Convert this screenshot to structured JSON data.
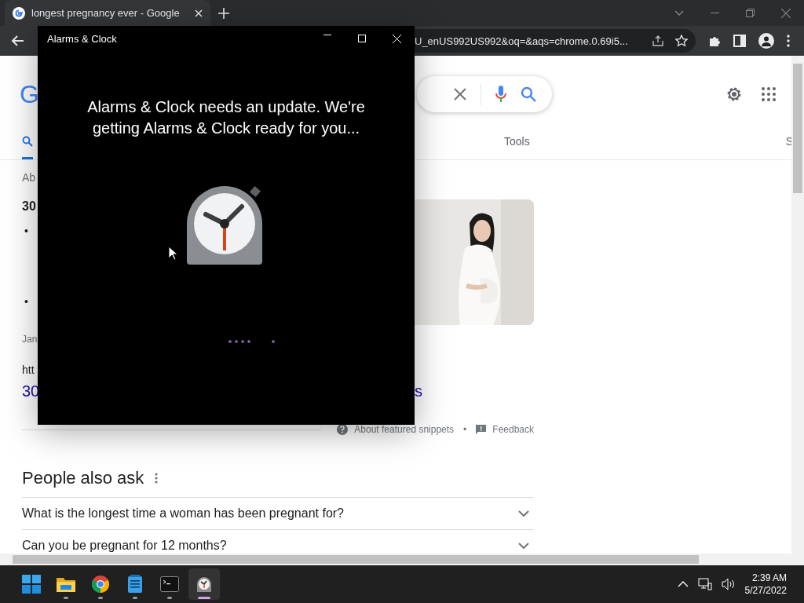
{
  "browser": {
    "tabs": [
      {
        "title": "longest pregnancy ever - Google",
        "selected": true
      }
    ],
    "omnibox": {
      "value": "U_enUS992US992&oq=&aqs=chrome.0.69i5..."
    }
  },
  "page": {
    "logo": "G",
    "nav": [
      {
        "kind": "search",
        "selected": true
      },
      {
        "kind": "text",
        "label": "Tools",
        "selected": false
      },
      {
        "kind": "text",
        "label": "S",
        "selected": false
      }
    ],
    "featured": {
      "about": "Ab",
      "heading": "30",
      "bullets": [
        "•",
        "•"
      ],
      "date": "Jan",
      "url": "htt",
      "link_start": "30",
      "link_end": "s"
    },
    "snippet_footer": {
      "about": "About featured snippets",
      "separator": "•",
      "feedback": "Feedback"
    },
    "people_also_ask": {
      "title": "People also ask",
      "questions": [
        "What is the longest time a woman has been pregnant for?",
        "Can you be pregnant for 12 months?"
      ]
    }
  },
  "app_window": {
    "title": "Alarms & Clock",
    "message": "Alarms & Clock needs an update. We're getting Alarms & Clock ready for you..."
  },
  "taskbar": {
    "apps": [
      {
        "selected": false
      },
      {
        "selected": false
      },
      {
        "selected": false
      },
      {
        "selected": false
      },
      {
        "selected": true
      }
    ],
    "clock": {
      "time": "2:39 AM",
      "date": "5/27/2022"
    }
  }
}
